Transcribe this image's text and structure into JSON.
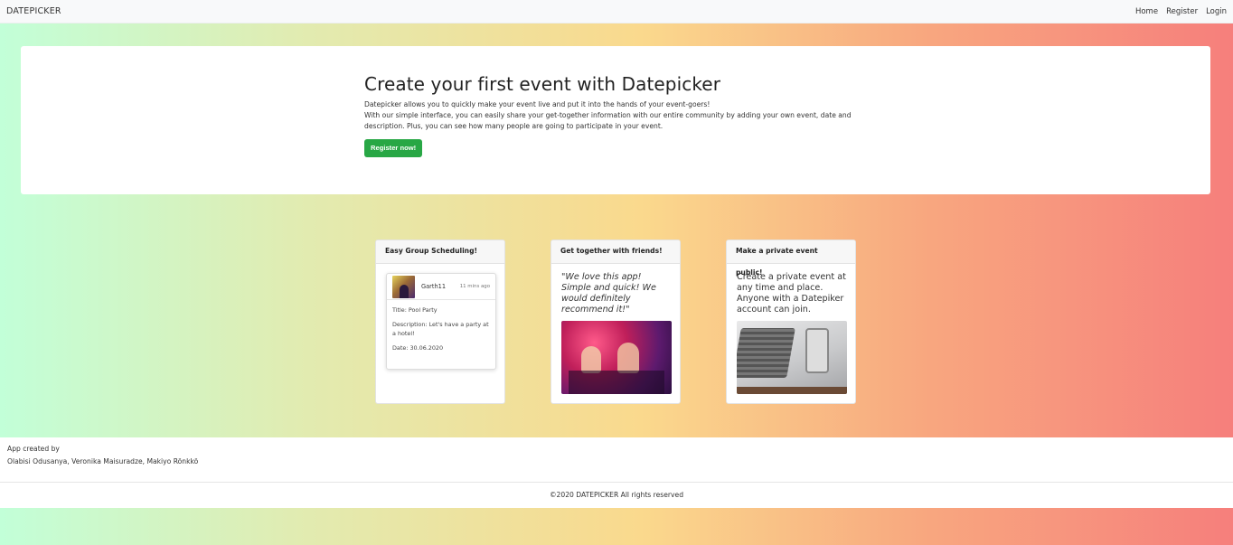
{
  "navbar": {
    "brand": "DATEPICKER",
    "links": [
      "Home",
      "Register",
      "Login"
    ]
  },
  "hero": {
    "title": "Create your first event with Datepicker",
    "line1": "Datepicker allows you to quickly make your event live and put it into the hands of your event-goers!",
    "line2": "With our simple interface, you can easily share your get-together information with our entire community by adding your own event, date and description. Plus, you can see how many people are going to participate in your event.",
    "button": "Register now!"
  },
  "cards": [
    {
      "header": "Easy Group Scheduling!",
      "post": {
        "user": "Garth11",
        "time": "11 mins ago",
        "title": "Title: Pool Party",
        "description": "Description: Let's have a party at a hotel!",
        "date": "Date: 30.06.2020"
      }
    },
    {
      "header": "Get together with friends!",
      "quote": "\"We love this app! Simple and quick! We would definitely recommend it!\""
    },
    {
      "header": "Make a private event public!",
      "text": "Create a private event at any time and place. Anyone with a Datepiker account can join."
    }
  ],
  "footer": {
    "created_by": "App created by",
    "authors": "Olabisi Odusanya, Veronika Maisuradze, Makiyo Rönkkö",
    "copyright": "©2020 DATEPICKER All rights reserved"
  }
}
